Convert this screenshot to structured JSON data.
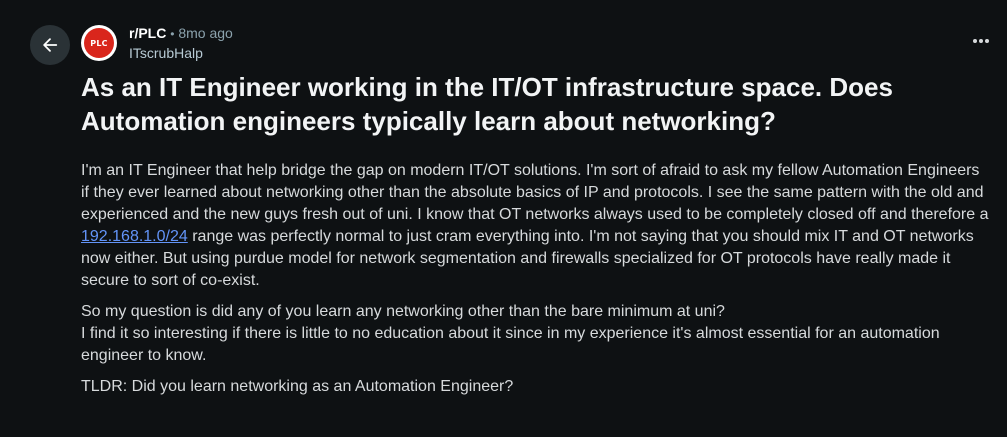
{
  "post": {
    "subreddit": "r/PLC",
    "separator": "•",
    "age": "8mo ago",
    "author": "ITscrubHalp",
    "avatar_text": "PLC",
    "title": "As an IT Engineer working in the IT/OT infrastructure space. Does Automation engineers typically learn about networking?",
    "body": {
      "p1_before_link": "I'm an IT Engineer that help bridge the gap on modern IT/OT solutions. I'm sort of afraid to ask my fellow Automation Engineers if they ever learned about networking other than the absolute basics of IP and protocols. I see the same pattern with the old and experienced and the new guys fresh out of uni. I know that OT networks always used to be completely closed off and therefore a ",
      "p1_link": "192.168.1.0/24",
      "p1_after_link": " range was perfectly normal to just cram everything into. I'm not saying that you should mix IT and OT networks now either. But using purdue model for network segmentation and firewalls specialized for OT protocols have really made it secure to sort of co-exist.",
      "p2_line1": "So my question is did any of you learn any networking other than the bare minimum at uni?",
      "p2_line2": "I find it so interesting if there is little to no education about it since in my experience it's almost essential for an automation engineer to know.",
      "p3": "TLDR: Did you learn networking as an Automation Engineer?"
    }
  },
  "icons": {
    "back": "arrow-left-icon",
    "more": "ellipsis-horizontal-icon"
  },
  "colors": {
    "background": "#0e1113",
    "back_button_bg": "#2a3236",
    "title": "#f2f4f5",
    "body": "#d7dadc",
    "meta": "#8ba2ad",
    "link": "#6394f8",
    "avatar_red": "#d9261c"
  }
}
